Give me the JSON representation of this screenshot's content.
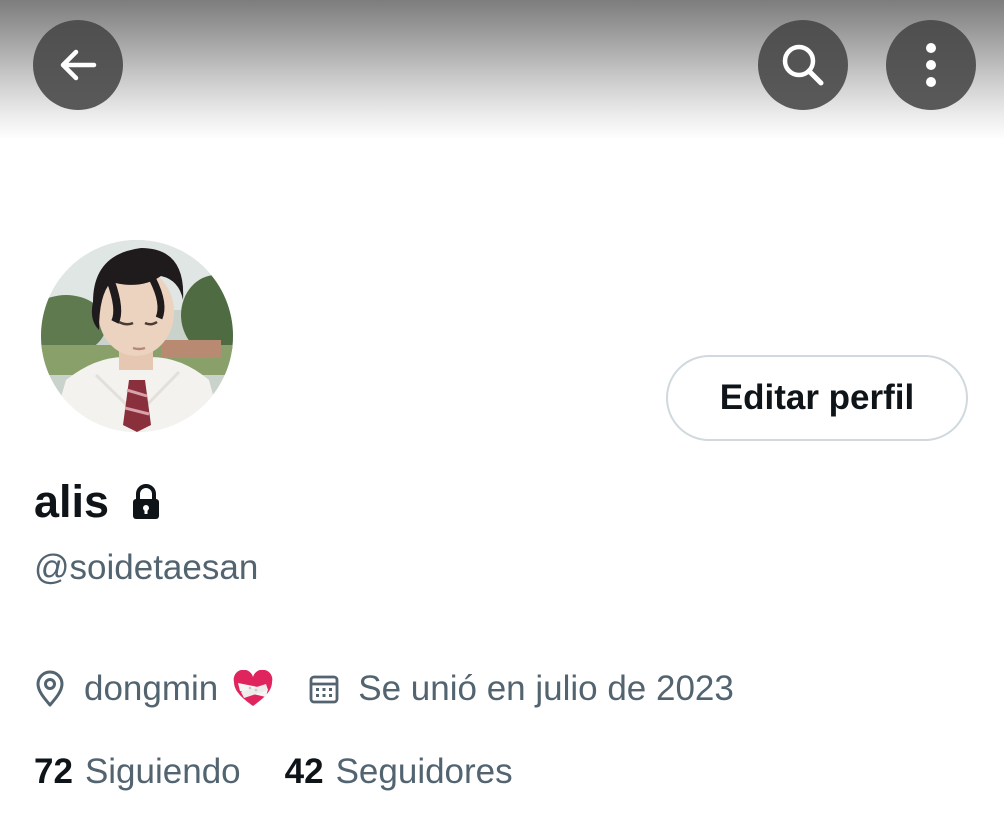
{
  "header": {
    "back_icon": "arrow-left-icon",
    "search_icon": "search-icon",
    "more_icon": "more-vertical-icon"
  },
  "profile": {
    "display_name": "alis",
    "protected_icon": "lock-icon",
    "handle": "@soidetaesan",
    "edit_button_label": "Editar perfil",
    "location_icon": "location-pin-icon",
    "location": "dongmin",
    "location_emoji_icon": "bandaged-heart-icon",
    "joined_icon": "calendar-icon",
    "joined": "Se unió en julio de 2023",
    "following_count": "72",
    "following_label": "Siguiendo",
    "followers_count": "42",
    "followers_label": "Seguidores"
  },
  "colors": {
    "text_primary": "#0f1419",
    "text_secondary": "#536471",
    "button_border": "#cfd9de",
    "heart_red": "#e0245e"
  }
}
